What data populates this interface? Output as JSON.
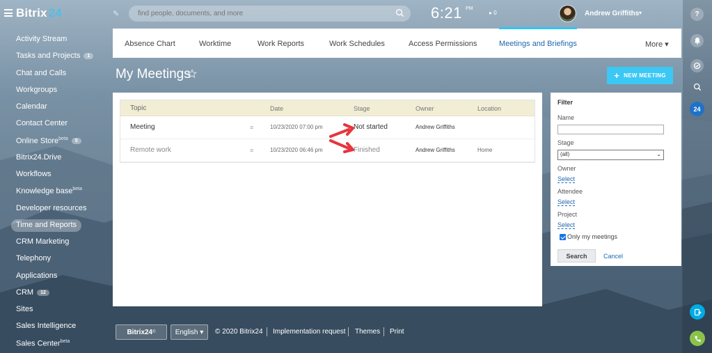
{
  "app": {
    "logo": "Bitrix",
    "logo_num": "24"
  },
  "topbar": {
    "search_placeholder": "find people, documents, and more",
    "time": "6:21",
    "ampm": "PM",
    "play_count": "▸ 0",
    "user_name": "Andrew Griffiths"
  },
  "sidebar": {
    "items": [
      {
        "label": "Activity Stream"
      },
      {
        "label": "Tasks and Projects",
        "badge": "1"
      },
      {
        "label": "Chat and Calls"
      },
      {
        "label": "Workgroups"
      },
      {
        "label": "Calendar"
      },
      {
        "label": "Contact Center"
      },
      {
        "label": "Online Store",
        "sup": "beta",
        "badge": "5"
      },
      {
        "label": "Bitrix24.Drive"
      },
      {
        "label": "Workflows"
      },
      {
        "label": "Knowledge base",
        "sup": "beta"
      },
      {
        "label": "Developer resources"
      },
      {
        "label": "Time and Reports",
        "active": true
      },
      {
        "label": "CRM Marketing"
      },
      {
        "label": "Telephony"
      },
      {
        "label": "Applications"
      },
      {
        "label": "CRM",
        "badge": "12"
      },
      {
        "label": "Sites"
      },
      {
        "label": "Sales Intelligence"
      },
      {
        "label": "Sales Center",
        "sup": "beta"
      }
    ]
  },
  "tabs": [
    {
      "label": "Absence Chart"
    },
    {
      "label": "Worktime"
    },
    {
      "label": "Work Reports"
    },
    {
      "label": "Work Schedules"
    },
    {
      "label": "Access Permissions"
    },
    {
      "label": "Meetings and Briefings",
      "active": true
    },
    {
      "label": "More ▾"
    }
  ],
  "page": {
    "title": "My Meetings",
    "new_button": "NEW MEETING"
  },
  "grid": {
    "columns": [
      "Topic",
      "Date",
      "Stage",
      "Owner",
      "Location"
    ],
    "rows": [
      {
        "topic": "Meeting",
        "date": "10/23/2020 07:00 pm",
        "stage": "Not started",
        "owner": "Andrew Griffiths",
        "location": ""
      },
      {
        "topic": "Remote work",
        "date": "10/23/2020 06:46 pm",
        "stage": "Finished",
        "owner": "Andrew Griffiths",
        "location": "Home"
      }
    ]
  },
  "filter": {
    "title": "Filter",
    "name_label": "Name",
    "name_value": "",
    "stage_label": "Stage",
    "stage_value": "(all)",
    "owner_label": "Owner",
    "owner_link": "Select",
    "attendee_label": "Attendee",
    "attendee_link": "Select",
    "project_label": "Project",
    "project_link": "Select",
    "only_mine_label": "Only my meetings",
    "only_mine_checked": true,
    "search_button": "Search",
    "cancel_link": "Cancel"
  },
  "footer": {
    "brand": "Bitrix24",
    "brand_mark": "©",
    "language": "English ▾",
    "copyright": "© 2020 Bitrix24",
    "links": [
      "Implementation request",
      "Themes",
      "Print"
    ]
  },
  "rail": {
    "badge_24": "24",
    "help": "?"
  },
  "colors": {
    "accent": "#3bc8f5",
    "link": "#2067b0",
    "header_row": "#f1eed5",
    "arrow": "#e8343c"
  }
}
